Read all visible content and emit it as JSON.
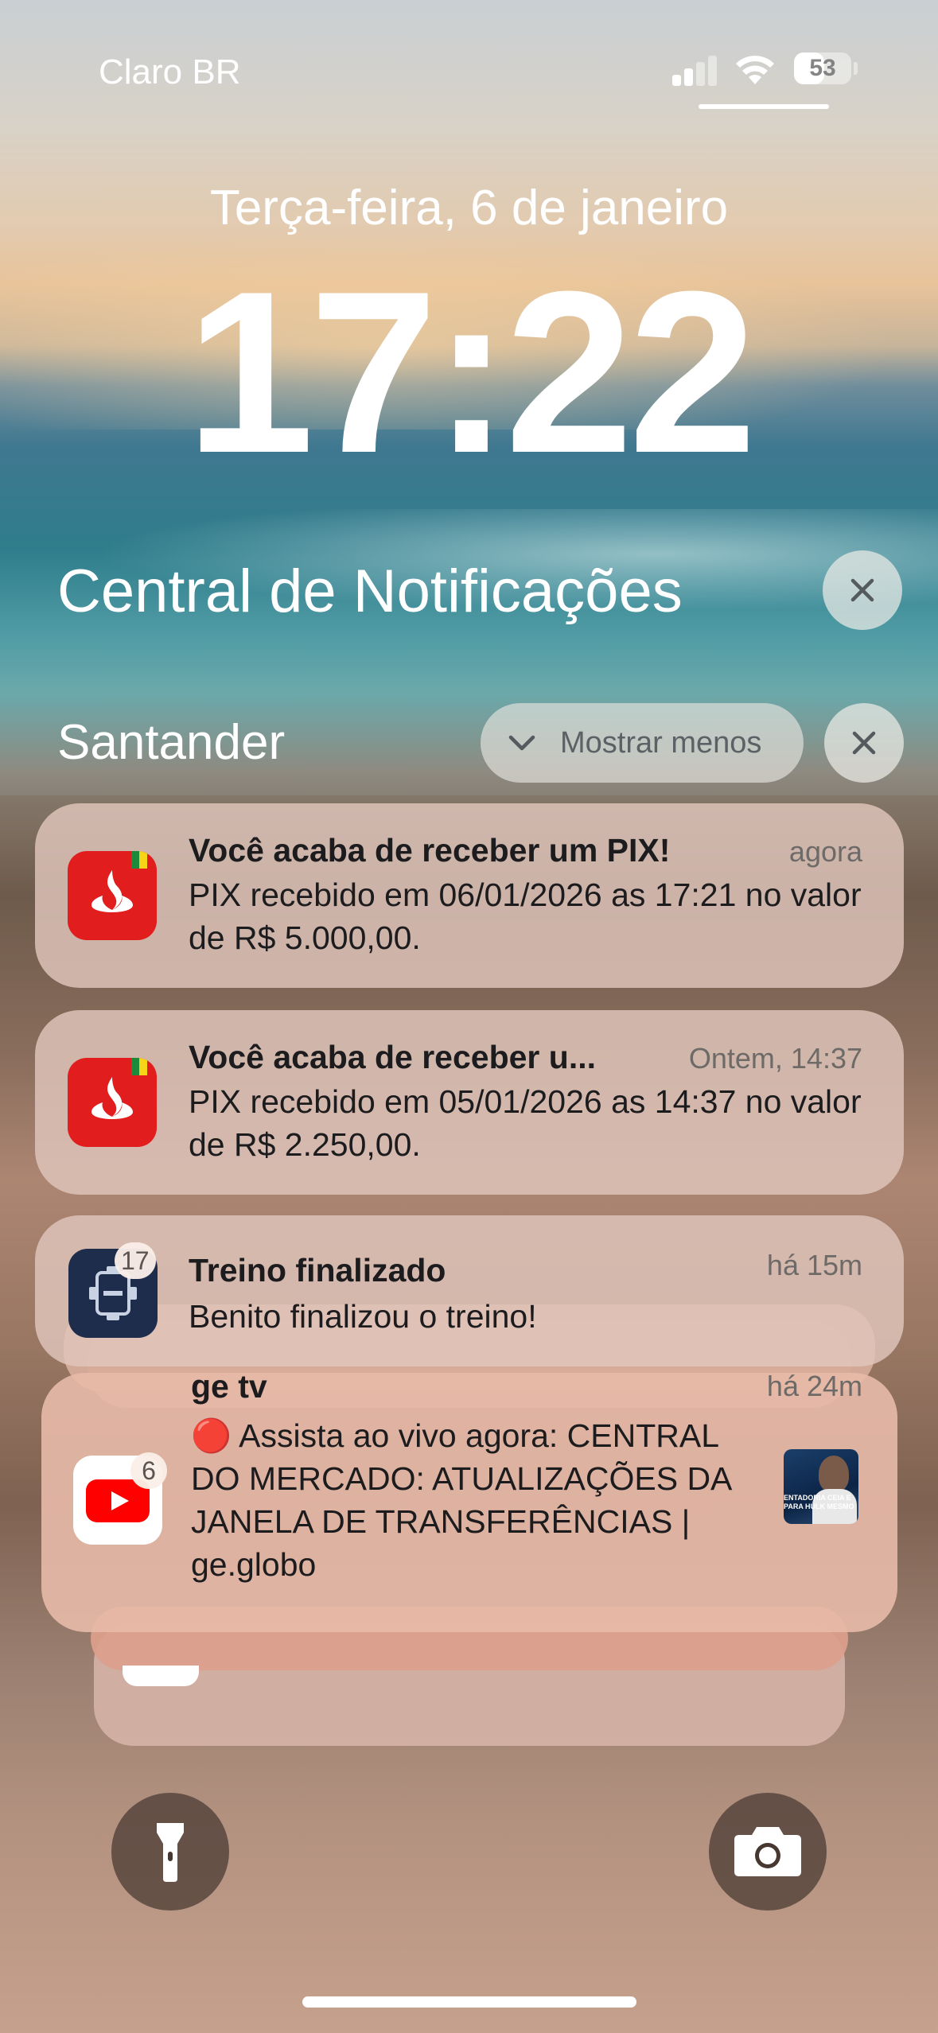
{
  "status_bar": {
    "carrier": "Claro BR",
    "battery": "53",
    "battery_level": 0.53
  },
  "lock_screen": {
    "date": "Terça-feira, 6 de janeiro",
    "time": "17:22"
  },
  "notification_center": {
    "title": "Central de Notificações"
  },
  "santander_group": {
    "title": "Santander",
    "show_less_label": "Mostrar menos"
  },
  "notifications": [
    {
      "app": "Santander",
      "title": "Você acaba de receber um PIX!",
      "time": "agora",
      "body": "PIX recebido em 06/01/2026 as 17:21 no valor de R$ 5.000,00."
    },
    {
      "app": "Santander",
      "title": "Você acaba de receber u...",
      "time": "Ontem, 14:37",
      "body": "PIX recebido em 05/01/2026 as 14:37 no valor de R$ 2.250,00."
    },
    {
      "app": "Treino",
      "badge": "17",
      "title": "Treino finalizado",
      "time": "há 15m",
      "body": "Benito finalizou o treino!"
    },
    {
      "app": "YouTube",
      "badge": "6",
      "title": "ge tv",
      "time": "há 24m",
      "body": "🔴 Assista ao vivo agora: CENTRAL DO MERCADO: ATUALIZAÇÕES DA JANELA DE TRANSFERÊNCIAS | ge.globo",
      "thumbnail_caption": "ENTADORIA CEIA E PARA HULK MESMO"
    }
  ],
  "icons": {
    "flashlight": "flashlight-icon",
    "camera": "camera-icon",
    "close": "close-icon",
    "chevron": "chevron-down-icon"
  },
  "colors": {
    "santander_red": "#e21d1d",
    "youtube_red": "#ff0000",
    "treino_blue": "#1f2d4d"
  }
}
